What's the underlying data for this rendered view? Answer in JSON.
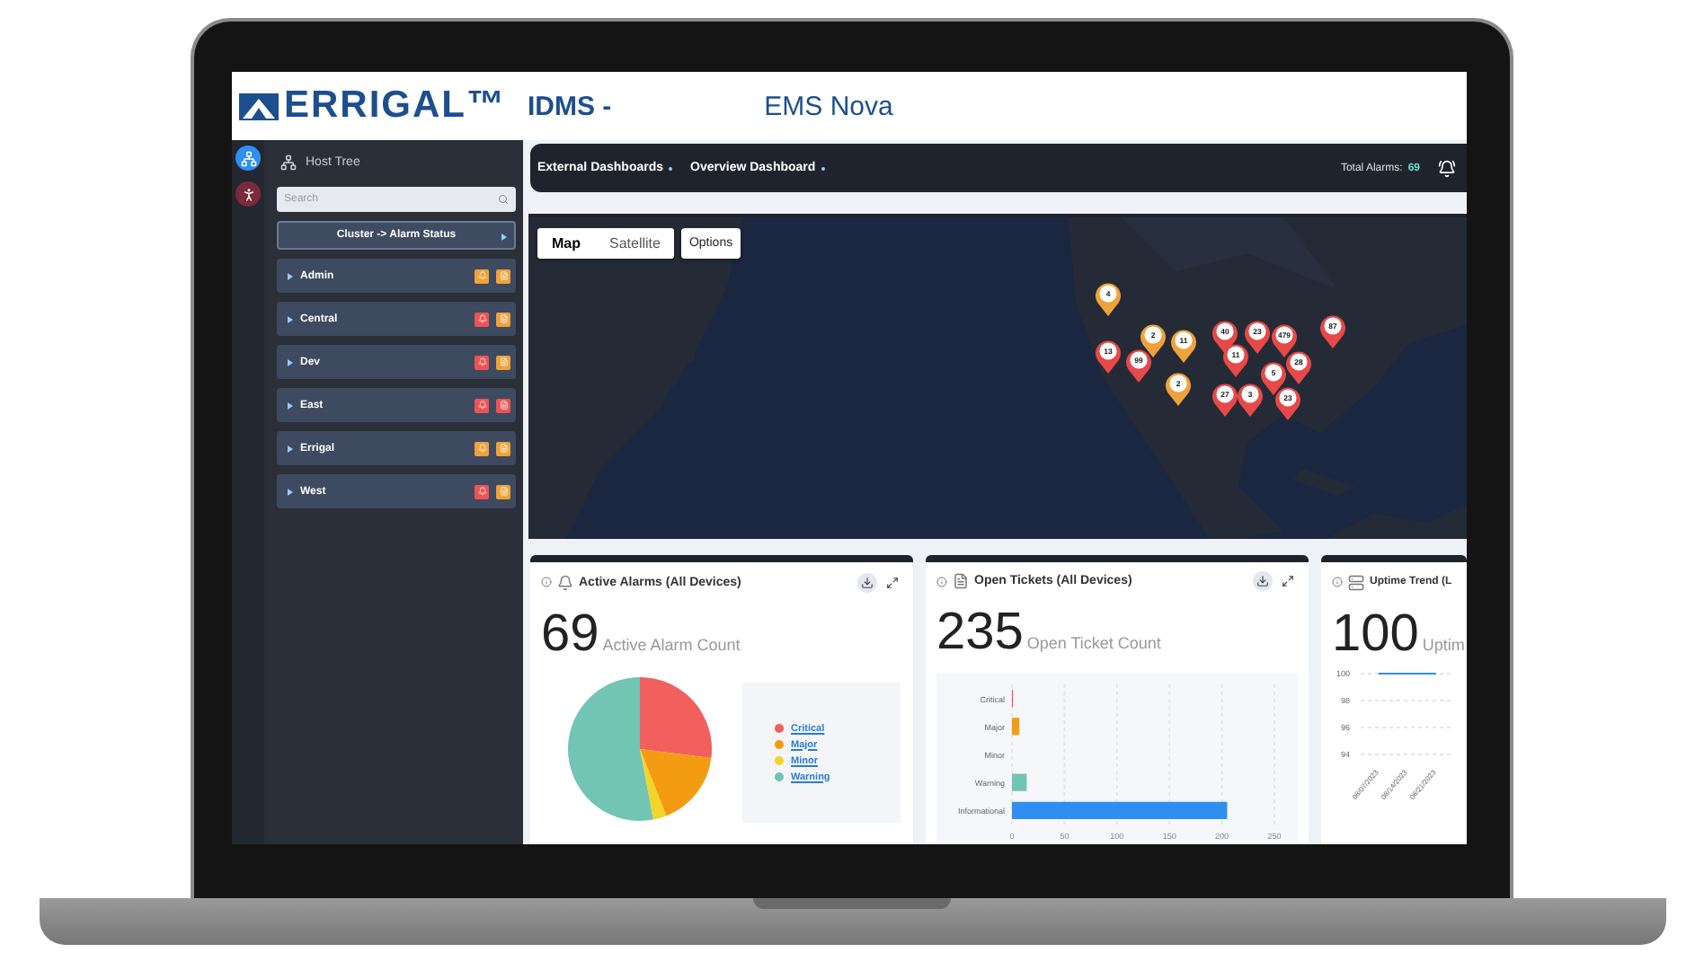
{
  "header": {
    "logo": "ERRIGAL™",
    "product": "IDMS -",
    "title": "EMS Nova"
  },
  "sidebar": {
    "title": "Host Tree",
    "search": {
      "placeholder": "Search"
    },
    "group_button": "Cluster -> Alarm Status",
    "clusters": [
      {
        "name": "Admin",
        "badges": [
          {
            "color": "#f0a23a"
          },
          {
            "color": "#f0a23a"
          }
        ]
      },
      {
        "name": "Central",
        "badges": [
          {
            "color": "#ec5454"
          },
          {
            "color": "#f0a23a"
          }
        ]
      },
      {
        "name": "Dev",
        "badges": [
          {
            "color": "#ec5454"
          },
          {
            "color": "#f0a23a"
          }
        ]
      },
      {
        "name": "East",
        "badges": [
          {
            "color": "#ec5454"
          },
          {
            "color": "#ec5454"
          }
        ]
      },
      {
        "name": "Errigal",
        "badges": [
          {
            "color": "#f0a23a"
          },
          {
            "color": "#f0a23a"
          }
        ]
      },
      {
        "name": "West",
        "badges": [
          {
            "color": "#ec5454"
          },
          {
            "color": "#f0a23a"
          }
        ]
      }
    ]
  },
  "navbar": {
    "menus": [
      "External Dashboards",
      "Overview Dashboard"
    ],
    "total_label": "Total Alarms:",
    "total_value": "69"
  },
  "map": {
    "tabs": [
      {
        "label": "Map",
        "selected": true
      },
      {
        "label": "Satellite",
        "selected": false
      }
    ],
    "options": "Options",
    "markers": [
      {
        "count": "4",
        "color": "#f0a23a"
      },
      {
        "count": "2",
        "color": "#f0a23a"
      },
      {
        "count": "11",
        "color": "#f0a23a"
      },
      {
        "count": "2",
        "color": "#f0a23a"
      },
      {
        "count": "13",
        "color": "#e84848"
      },
      {
        "count": "99",
        "color": "#e84848"
      },
      {
        "count": "40",
        "color": "#e84848"
      },
      {
        "count": "23",
        "color": "#e84848"
      },
      {
        "count": "479",
        "color": "#e84848"
      },
      {
        "count": "87",
        "color": "#e84848"
      },
      {
        "count": "11",
        "color": "#e84848"
      },
      {
        "count": "28",
        "color": "#e84848"
      },
      {
        "count": "5",
        "color": "#e84848"
      },
      {
        "count": "27",
        "color": "#e84848"
      },
      {
        "count": "3",
        "color": "#e84848"
      },
      {
        "count": "23",
        "color": "#e84848"
      }
    ]
  },
  "cards": [
    {
      "kind": "pie",
      "title": "Active Alarms (All Devices)",
      "count": "69",
      "caption": "Active Alarm Count",
      "legend": [
        {
          "label": "Critical",
          "color": "#f25f5c"
        },
        {
          "label": "Major",
          "color": "#f39c12"
        },
        {
          "label": "Minor",
          "color": "#f5d42a"
        },
        {
          "label": "Warning",
          "color": "#72c4b4"
        }
      ]
    },
    {
      "kind": "bar",
      "title": "Open Tickets (All Devices)",
      "count": "235",
      "caption": "Open Ticket Count",
      "chart_data": {
        "type": "bar",
        "orientation": "horizontal",
        "grid": true,
        "categories": [
          "Critical",
          "Major",
          "Minor",
          "Warning",
          "Informational"
        ],
        "xlim": [
          0,
          250
        ],
        "xticks": [
          0,
          50,
          100,
          150,
          200,
          250
        ],
        "series": [
          {
            "color": "#ec5454",
            "values": [
              1,
              null,
              null,
              null,
              null
            ]
          },
          {
            "color": "#f39c12",
            "values": [
              null,
              7,
              null,
              null,
              null
            ]
          },
          {
            "color": "#72c4b4",
            "values": [
              null,
              null,
              null,
              14,
              null
            ]
          },
          {
            "color": "#2f8ef0",
            "values": [
              null,
              null,
              null,
              null,
              205
            ]
          }
        ]
      }
    },
    {
      "kind": "line",
      "title": "Uptime Trend (L",
      "count": "100",
      "caption": "Uptim",
      "chart_data": {
        "type": "line",
        "grid": true,
        "x": [
          "08/07/2023",
          "08/14/2023",
          "08/21/2023"
        ],
        "ylim": [
          94,
          100
        ],
        "yticks": [
          94,
          96,
          98,
          100
        ],
        "series": [
          {
            "color": "#2f8ef0",
            "values": [
              100,
              100,
              100
            ]
          }
        ]
      }
    }
  ]
}
